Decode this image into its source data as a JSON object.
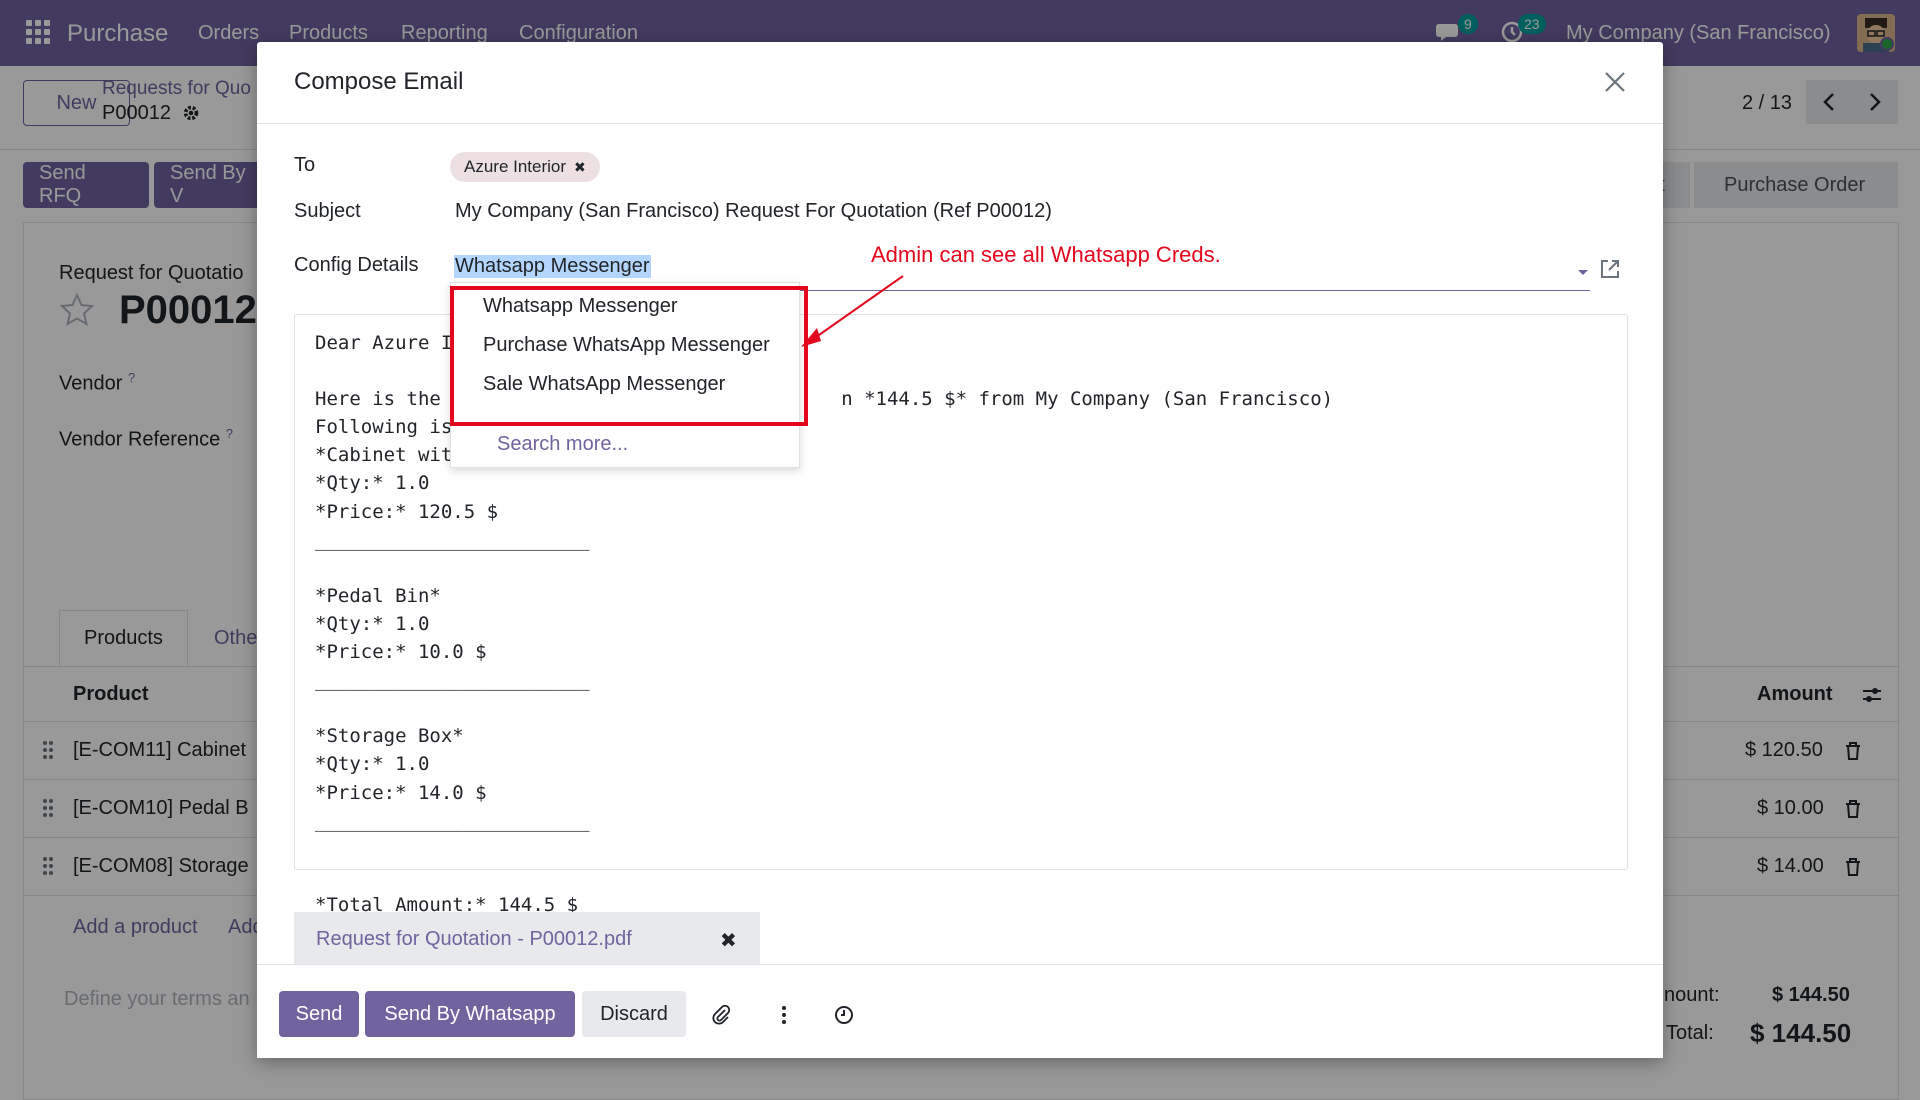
{
  "navbar": {
    "app_name": "Purchase",
    "menu": [
      "Orders",
      "Products",
      "Reporting",
      "Configuration"
    ],
    "messages_count": "9",
    "activities_count": "23",
    "company": "My Company (San Francisco)"
  },
  "control_panel": {
    "new_label": "New",
    "breadcrumb": "Requests for Quo",
    "record": "P00012",
    "pager": "2 / 13"
  },
  "actions": {
    "send_rfq": "Send RFQ",
    "send_by": "Send By V",
    "status_partial": "nt",
    "status_purchase_order": "Purchase Order"
  },
  "form": {
    "title_label": "Request for Quotatio",
    "name": "P00012",
    "vendor_label": "Vendor",
    "vendor_ref_label": "Vendor Reference",
    "help_mark": "?",
    "tab_products": "Products",
    "tab_other": "Othe",
    "col_product": "Product",
    "col_amount": "Amount",
    "rows": [
      {
        "product": "[E-COM11] Cabinet",
        "amount": "$ 120.50"
      },
      {
        "product": "[E-COM10] Pedal B",
        "amount": "$ 10.00"
      },
      {
        "product": "[E-COM08] Storage",
        "amount": "$ 14.00"
      }
    ],
    "add_product": "Add a product",
    "add_other": "Add",
    "terms_placeholder": "Define your terms an",
    "untaxed_label": "nount:",
    "untaxed_value": "$ 144.50",
    "total_label": "Total:",
    "total_value": "$ 144.50"
  },
  "modal": {
    "title": "Compose Email",
    "to_label": "To",
    "to_tag": "Azure Interior",
    "subject_label": "Subject",
    "subject_value": "My Company (San Francisco) Request For Quotation (Ref P00012)",
    "config_label": "Config Details",
    "config_value": "Whatsapp Messenger",
    "body_lines": [
      "Dear Azure I",
      "",
      "Here is the                                   n *144.5 $* from My Company (San Francisco)",
      "Following is",
      "*Cabinet wit",
      "*Qty:* 1.0",
      "*Price:* 120.5 $",
      "________________________",
      "",
      "*Pedal Bin*",
      "*Qty:* 1.0",
      "*Price:* 10.0 $",
      "________________________",
      "",
      "*Storage Box*",
      "*Qty:* 1.0",
      "*Price:* 14.0 $",
      "________________________",
      "",
      "",
      "*Total Amount:* 144.5 $"
    ],
    "dropdown_options": [
      "Whatsapp Messenger",
      "Purchase WhatsApp Messenger",
      "Sale WhatsApp Messenger"
    ],
    "search_more": "Search more...",
    "annotation": "Admin can see all Whatsapp Creds.",
    "attachment": "Request for Quotation - P00012.pdf",
    "send": "Send",
    "send_whatsapp": "Send By Whatsapp",
    "discard": "Discard"
  },
  "colors": {
    "brand": "#71639e",
    "annotation_red": "#e3061c",
    "badge_teal": "#00a09d"
  }
}
